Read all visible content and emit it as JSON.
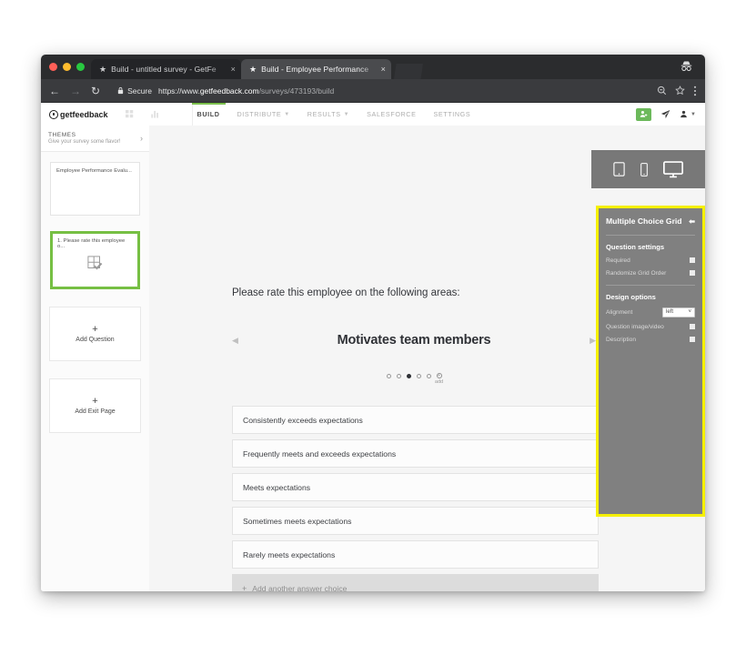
{
  "browser": {
    "tabs": [
      {
        "title": "Build - untitled survey - GetFe",
        "favicon": "star-icon",
        "active": false
      },
      {
        "title": "Build - Employee Performance",
        "favicon": "star-icon",
        "active": true
      }
    ],
    "close_label": "×",
    "back_icon": "back-arrow-icon",
    "forward_icon": "forward-arrow-icon",
    "reload_icon": "reload-icon",
    "security_label": "Secure",
    "url_scheme": "https://www.",
    "url_host": "getfeedback.com",
    "url_path": "/surveys/473193/build",
    "incognito_icon": "incognito-icon",
    "zoom_icon": "zoom-out-icon",
    "bookmark_icon": "star-outline-icon",
    "menu_icon": "three-dot-menu-icon"
  },
  "app_header": {
    "logo_get": "get",
    "logo_feedback": "feedback",
    "apps_icon": "apps-grid-icon",
    "reports_icon": "bar-chart-icon",
    "nav": [
      {
        "label": "BUILD",
        "active": true,
        "caret": false
      },
      {
        "label": "DISTRIBUTE",
        "active": false,
        "caret": true
      },
      {
        "label": "RESULTS",
        "active": false,
        "caret": true
      },
      {
        "label": "SALESFORCE",
        "active": false,
        "caret": false
      },
      {
        "label": "SETTINGS",
        "active": false,
        "caret": false
      }
    ],
    "add_user_icon": "add-user-icon",
    "send_icon": "paper-plane-icon",
    "account_icon": "user-icon",
    "accent_green": "#6cb95b",
    "active_underline": "#7bbf4c"
  },
  "sidebar": {
    "themes_title": "THEMES",
    "themes_subtitle": "Give your survey some flavor!",
    "themes_chevron": "›",
    "survey_title": "Employee Performance Evalu...",
    "question_card": {
      "label": "1. Please rate this employee o...",
      "icon": "grid-check-icon",
      "selected_color": "#76bf43"
    },
    "add_question": {
      "plus": "+",
      "label": "Add Question"
    },
    "add_exit_page": {
      "plus": "+",
      "label": "Add Exit Page"
    }
  },
  "device_bar": {
    "tablet_icon": "tablet-icon",
    "mobile_icon": "mobile-icon",
    "desktop_icon": "desktop-icon",
    "selected": "desktop"
  },
  "canvas": {
    "question_text": "Please rate this employee on the following areas:",
    "row_title": "Motivates team members",
    "prev_arrow": "◀",
    "next_arrow": "▶",
    "pager": {
      "total": 5,
      "active_index": 2,
      "add_label": "add",
      "add_plus": "+"
    },
    "choices": [
      "Consistently exceeds expectations",
      "Frequently meets and exceeds expectations",
      "Meets expectations",
      "Sometimes meets expectations",
      "Rarely meets expectations"
    ],
    "add_choice": {
      "plus": "+",
      "label": "Add another answer choice"
    }
  },
  "settings_panel": {
    "title": "Multiple Choice Grid",
    "collapse_icon": "collapse-arrow-icon",
    "highlight_color": "#f5f000",
    "background_color": "#808080",
    "question_settings": {
      "heading": "Question settings",
      "options": [
        {
          "label": "Required",
          "checked": false
        },
        {
          "label": "Randomize Grid Order",
          "checked": false
        }
      ]
    },
    "design_options": {
      "heading": "Design options",
      "alignment": {
        "label": "Alignment",
        "value": "left",
        "caret": "⌄"
      },
      "options": [
        {
          "label": "Question image/video",
          "checked": false
        },
        {
          "label": "Description",
          "checked": false
        }
      ]
    }
  }
}
